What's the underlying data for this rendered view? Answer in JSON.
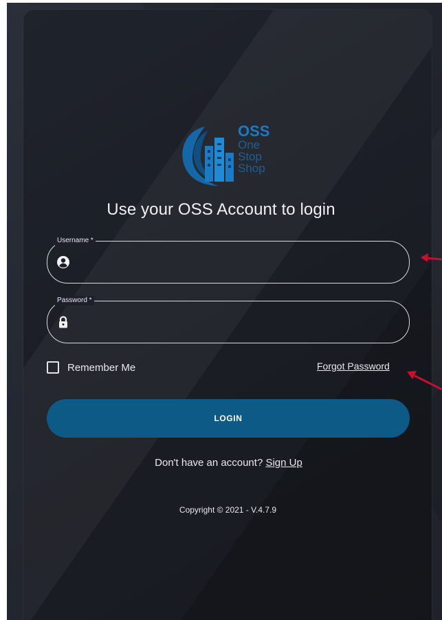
{
  "logo": {
    "name": "oss-logo",
    "line1": "OSS",
    "line2": "One",
    "line3": "Stop",
    "line4": "Shop"
  },
  "login_form": {
    "title": "Use your OSS Account to login",
    "username": {
      "label": "Username *",
      "value": "",
      "icon": "user-icon"
    },
    "password": {
      "label": "Password *",
      "value": "",
      "icon": "lock-icon"
    },
    "remember_me_label": "Remember Me",
    "remember_me_checked": false,
    "forgot_password_label": "Forgot Password",
    "login_button_label": "LOGIN",
    "signup_prompt": "Don't have an account?",
    "signup_link_label": "Sign Up",
    "copyright": "Copyright © 2021 - V.4.7.9"
  },
  "colors": {
    "accent": "#0e5a86",
    "logo_blue": "#1a7bc4",
    "annotation_arrow": "#c8102e"
  }
}
